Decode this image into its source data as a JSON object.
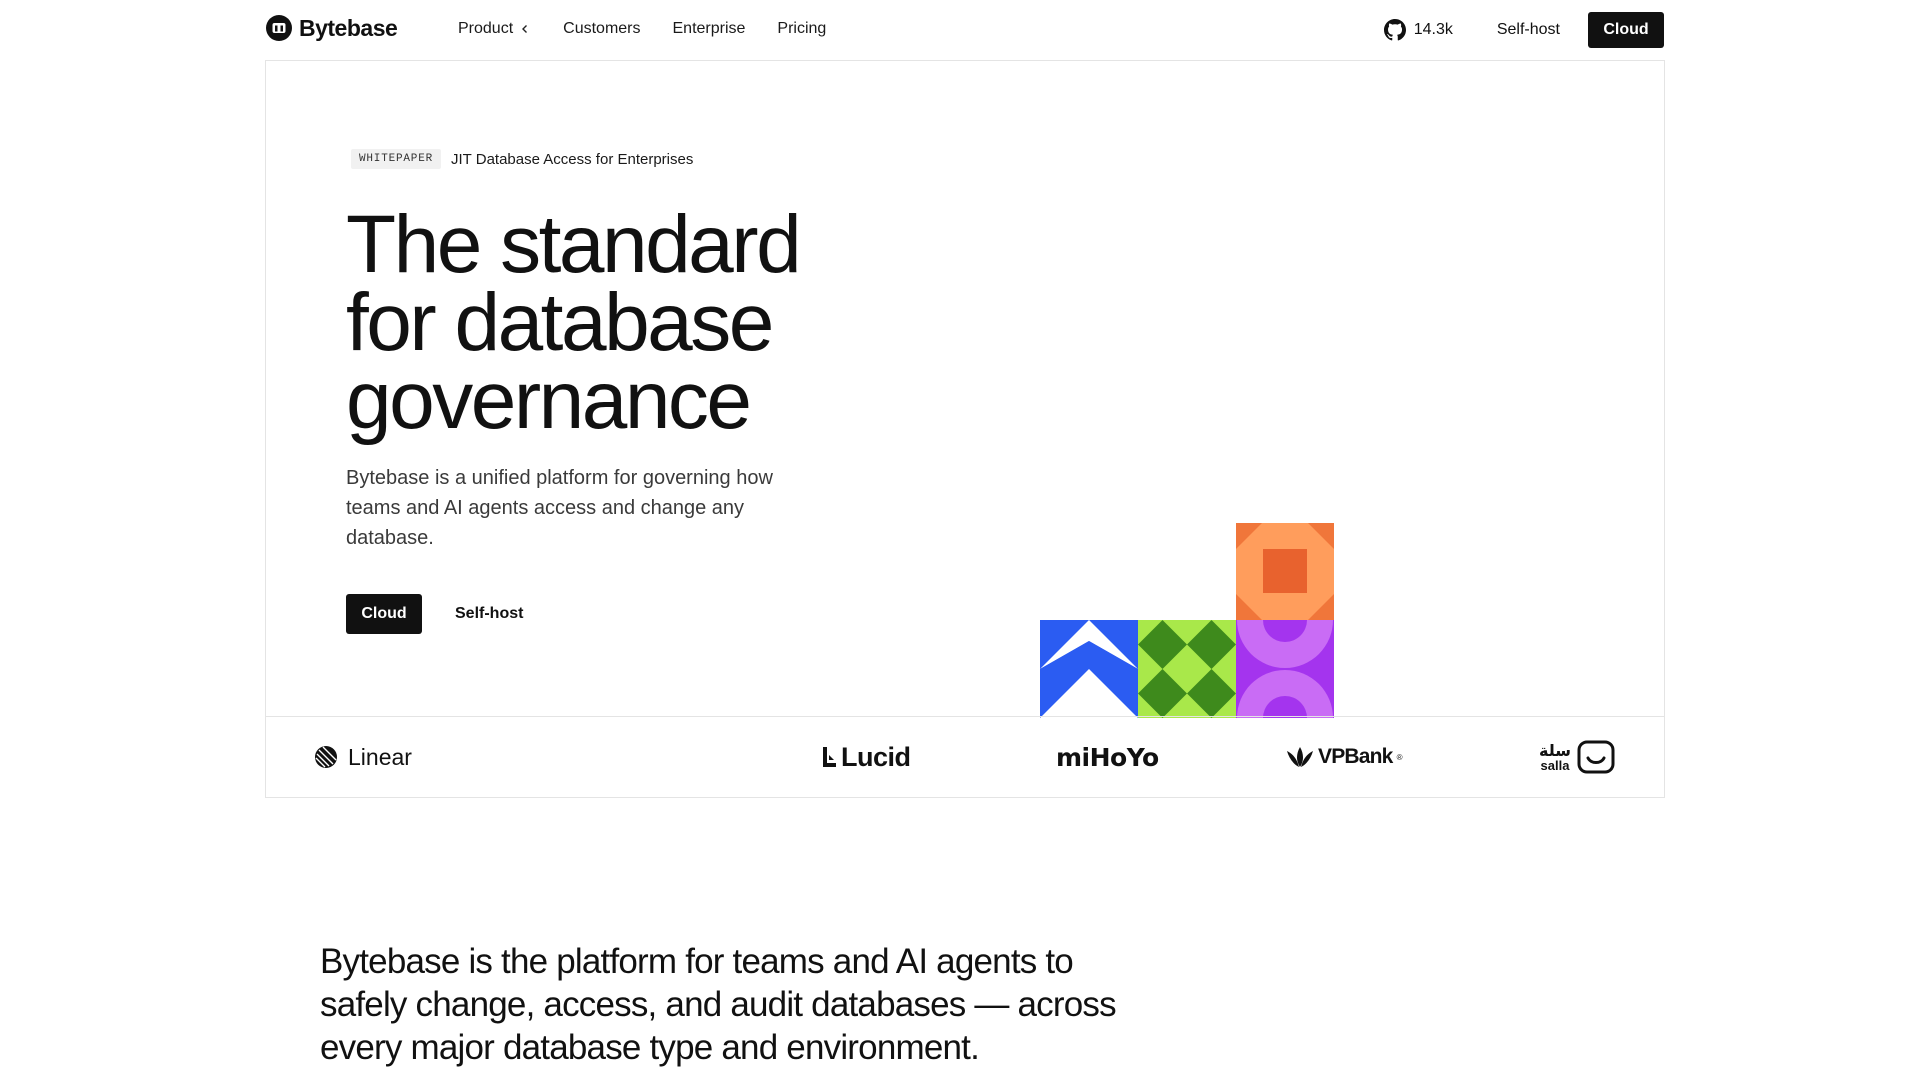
{
  "nav": {
    "brand": "Bytebase",
    "links": [
      {
        "label": "Product",
        "icon": "chevron-left-icon"
      },
      {
        "label": "Customers"
      },
      {
        "label": "Enterprise"
      },
      {
        "label": "Pricing"
      }
    ],
    "github_stars": "14.3k",
    "self_host_label": "Self-host",
    "cloud_label": "Cloud"
  },
  "hero": {
    "badge": "WHITEPAPER",
    "badge_text": "JIT Database Access for Enterprises",
    "title_lines": [
      "The standard",
      "for database",
      "governance"
    ],
    "lead": "Bytebase is a unified platform for governing how teams and AI agents access and change any database.",
    "cta_primary": "Cloud",
    "cta_secondary": "Self-host"
  },
  "customers": [
    {
      "name": "Linear",
      "icon": "linear-logo-icon"
    },
    {
      "name": "Lucid",
      "icon": "lucid-logo-icon"
    },
    {
      "name": "miHoYo"
    },
    {
      "name": "VPBank",
      "mark": "®",
      "icon": "vpbank-lotus-icon"
    },
    {
      "name": "salla",
      "arabic": "سلة",
      "icon": "salla-bag-icon"
    }
  ],
  "statement_lines": [
    "Bytebase is the platform for teams and AI agents to",
    "safely change, access, and audit databases — across",
    "every major database type and environment."
  ],
  "colors": {
    "primary": "#111111",
    "border": "#e4e4e4",
    "art_blue": "#2b5cf2",
    "art_green_light": "#a9e84a",
    "art_green_dark": "#3e8a1c",
    "art_orange": "#f0763a",
    "art_orange_light": "#ff9d5c",
    "art_purple": "#a434ee",
    "art_purple_light": "#c96cf5"
  }
}
